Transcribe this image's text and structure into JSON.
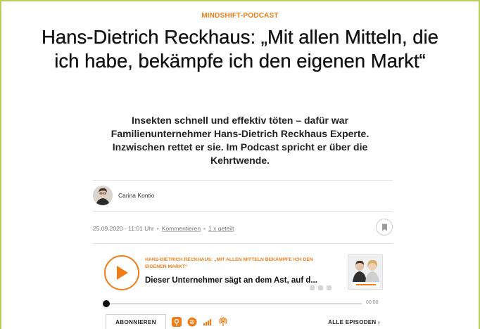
{
  "article": {
    "kicker": "MINDSHIFT-PODCAST",
    "headline": "Hans-Dietrich Reckhaus: „Mit allen Mitteln, die ich habe, bekämpfe ich den eigenen Markt“",
    "teaser": "Insekten schnell und effektiv töten – dafür war Familienunternehmer Hans-Dietrich Reckhaus Experte. Inzwischen rettet er sie. Im Podcast spricht er über die Kehrtwende."
  },
  "author": {
    "name": "Carina Kontio"
  },
  "meta": {
    "date_time": "25.09.2020 - 11:01 Uhr",
    "separator": "•",
    "comments_label": "Kommentieren",
    "shares_label": "1 x geteilt"
  },
  "player": {
    "series_title": "HANS-DIETRICH RECKHAUS: „MIT ALLEN MITTELN BEKÄMPFE ICH DEN EIGENEN MARKT“",
    "episode_title": "Dieser Unternehmer sägt an dem Ast, auf d...",
    "time": "00:00",
    "progress": 0,
    "subscribe_label": "ABONNIEREN",
    "all_episodes_label": "ALLE EPISODEN ›",
    "platforms": [
      "apple-podcasts-icon",
      "spotify-icon",
      "deezer-icon",
      "podcast-rss-icon"
    ]
  },
  "colors": {
    "accent": "#f07d17",
    "frame": "#b7cf5a",
    "text": "#111111"
  }
}
